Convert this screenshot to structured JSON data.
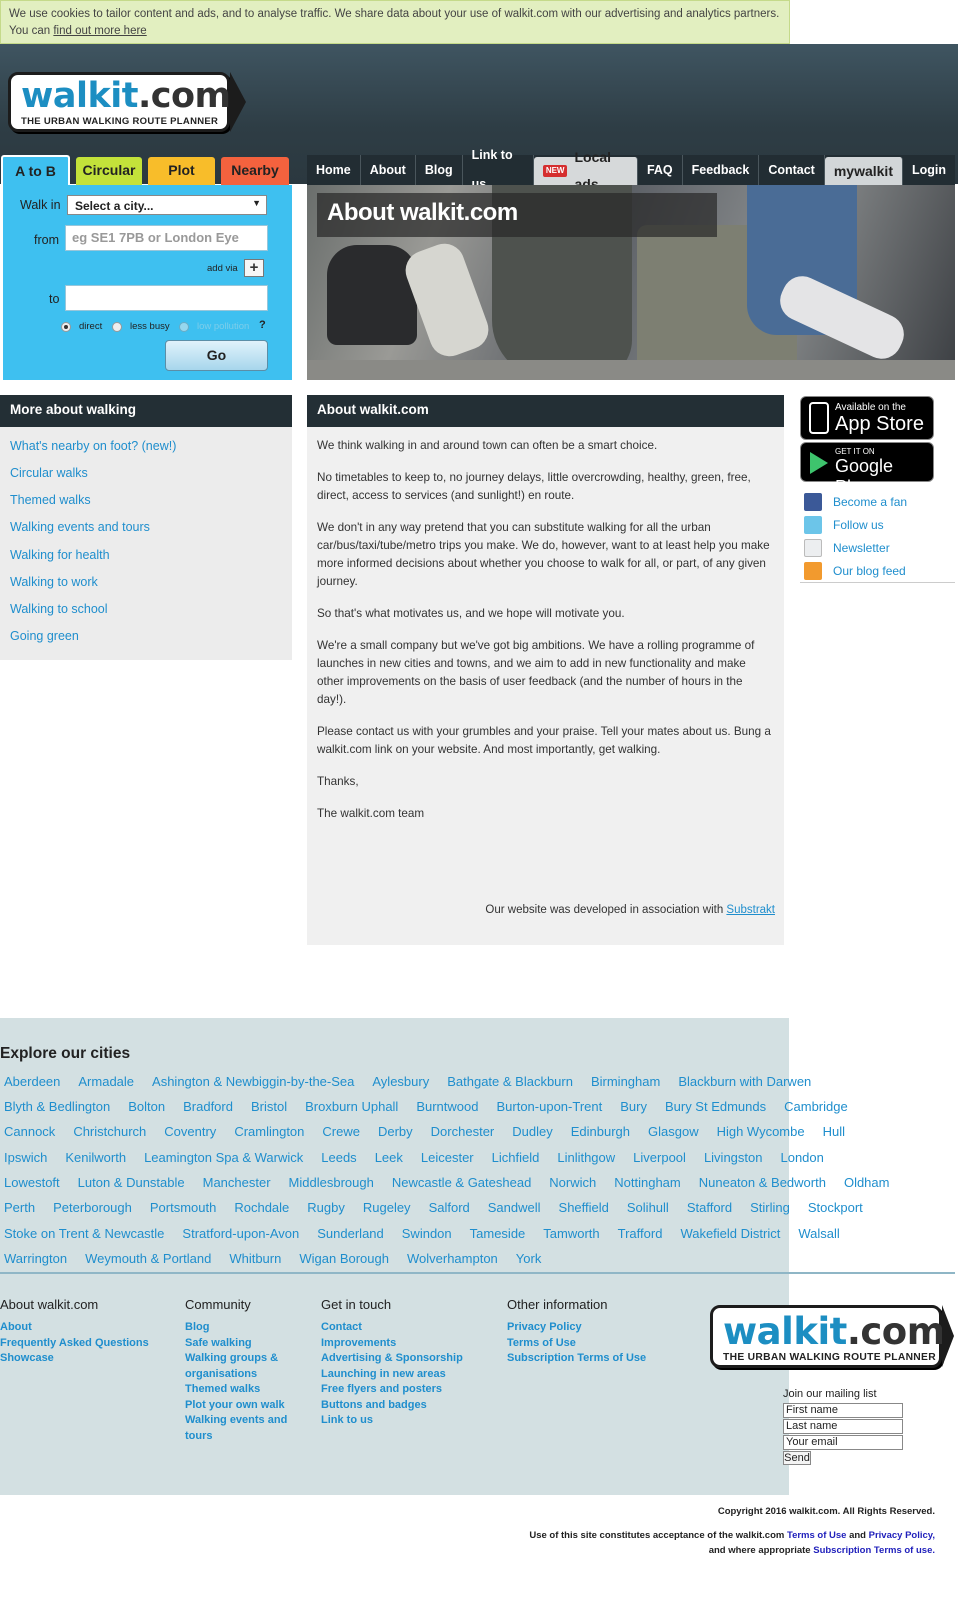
{
  "cookie": {
    "text": "We use cookies to tailor content and ads, and to analyse traffic. We share data about your use of walkit.com with our advertising and analytics partners. You can",
    "link": "find out more here"
  },
  "logo": {
    "walk": "walkit",
    "dotcom": ".com",
    "tagline": "THE URBAN WALKING ROUTE PLANNER"
  },
  "route_tabs": [
    "A to B",
    "Circular",
    "Plot",
    "Nearby"
  ],
  "nav": [
    "Home",
    "About",
    "Blog",
    "Link to us",
    "Local ads",
    "FAQ",
    "Feedback",
    "Contact",
    "mywalkit",
    "Login"
  ],
  "nav_new_badge": "NEW",
  "planner": {
    "walk_in_label": "Walk in",
    "city_select": "Select a city...",
    "from_label": "from",
    "from_placeholder": "eg SE1 7PB or London Eye",
    "add_via": "add via",
    "plus": "+",
    "to_label": "to",
    "options": [
      "direct",
      "less busy",
      "low pollution"
    ],
    "help": "?",
    "go": "Go"
  },
  "hero_title": "About walkit.com",
  "sidebar": {
    "title": "More about walking",
    "links": [
      "What's nearby on foot? (new!)",
      "Circular walks",
      "Themed walks",
      "Walking events and tours",
      "Walking for health",
      "Walking to work",
      "Walking to school",
      "Going green"
    ]
  },
  "main": {
    "title": "About walkit.com",
    "paragraphs": [
      "We think walking in and around town can often be a smart choice.",
      "No timetables to keep to, no journey delays, little overcrowding, healthy, green, free, direct, access to services (and sunlight!) en route.",
      "We don't in any way pretend that you can substitute walking for all the urban car/bus/taxi/tube/metro trips you make. We do, however, want to at least help you make more informed decisions about whether you choose to walk for all, or part, of any given journey.",
      "So that's what motivates us, and we hope will motivate you.",
      "We're a small company but we've got big ambitions. We have a rolling programme of launches in new cities and towns, and we aim to add in new functionality and make other improvements on the basis of user feedback (and the number of hours in the day!).",
      "Please contact us with your grumbles and your praise. Tell your mates about us. Bung a walkit.com link on your website. And most importantly, get walking.",
      "Thanks,",
      "The walkit.com team"
    ],
    "credit_text": "Our website was developed in association with",
    "credit_link": "Substrakt"
  },
  "badges": {
    "appstore_small": "Available on the",
    "appstore_big": "App Store",
    "gplay_small": "GET IT ON",
    "gplay_big": "Google Play"
  },
  "social": [
    "Become a fan",
    "Follow us",
    "Newsletter",
    "Our blog feed"
  ],
  "cities": {
    "title": "Explore our cities",
    "rows": [
      [
        "Aberdeen",
        "Armadale",
        "Ashington & Newbiggin-by-the-Sea",
        "Aylesbury",
        "Bathgate & Blackburn",
        "Birmingham",
        "Blackburn with Darwen"
      ],
      [
        "Blyth & Bedlington",
        "Bolton",
        "Bradford",
        "Bristol",
        "Broxburn Uphall",
        "Burntwood",
        "Burton-upon-Trent",
        "Bury",
        "Bury St Edmunds",
        "Cambridge"
      ],
      [
        "Cannock",
        "Christchurch",
        "Coventry",
        "Cramlington",
        "Crewe",
        "Derby",
        "Dorchester",
        "Dudley",
        "Edinburgh",
        "Glasgow",
        "High Wycombe",
        "Hull"
      ],
      [
        "Ipswich",
        "Kenilworth",
        "Leamington Spa & Warwick",
        "Leeds",
        "Leek",
        "Leicester",
        "Lichfield",
        "Linlithgow",
        "Liverpool",
        "Livingston",
        "London"
      ],
      [
        "Lowestoft",
        "Luton & Dunstable",
        "Manchester",
        "Middlesbrough",
        "Newcastle & Gateshead",
        "Norwich",
        "Nottingham",
        "Nuneaton & Bedworth",
        "Oldham"
      ],
      [
        "Perth",
        "Peterborough",
        "Portsmouth",
        "Rochdale",
        "Rugby",
        "Rugeley",
        "Salford",
        "Sandwell",
        "Sheffield",
        "Solihull",
        "Stafford",
        "Stirling",
        "Stockport"
      ],
      [
        "Stoke on Trent & Newcastle",
        "Stratford-upon-Avon",
        "Sunderland",
        "Swindon",
        "Tameside",
        "Tamworth",
        "Trafford",
        "Wakefield District",
        "Walsall"
      ],
      [
        "Warrington",
        "Weymouth & Portland",
        "Whitburn",
        "Wigan Borough",
        "Wolverhampton",
        "York"
      ]
    ]
  },
  "footer": {
    "cols": [
      {
        "title": "About walkit.com",
        "links": [
          "About",
          "Frequently Asked Questions",
          "Showcase"
        ]
      },
      {
        "title": "Community",
        "links": [
          "Blog",
          "Safe walking",
          "Walking groups &",
          "organisations",
          "Themed walks",
          "Plot your own walk",
          "Walking events and",
          "tours"
        ]
      },
      {
        "title": "Get in touch",
        "links": [
          "Contact",
          "Improvements",
          "Advertising & Sponsorship",
          "Launching in new areas",
          "Free flyers and posters",
          "Buttons and badges",
          "Link to us"
        ]
      },
      {
        "title": "Other information",
        "links": [
          "Privacy Policy",
          "Terms of Use",
          "Subscription Terms of Use"
        ]
      }
    ],
    "mailing": {
      "title": "Join our mailing list",
      "first": "First name",
      "last": "Last name",
      "email": "Your email",
      "send": "Send"
    },
    "copyright": "Copyright 2016 walkit.com. All Rights Reserved.",
    "legal1a": "Use of this site constitutes acceptance of the walkit.com",
    "legal1b": "Terms of Use",
    "legal1c": "and",
    "legal1d": "Privacy Policy,",
    "legal2a": "and where appropriate",
    "legal2b": "Subscription Terms of use."
  },
  "colors": {
    "accent": "#1f8ecd",
    "planner_bg": "#3ec0f0",
    "header_bg": "#2e3d45",
    "cities_bg": "#d3e0e2"
  }
}
